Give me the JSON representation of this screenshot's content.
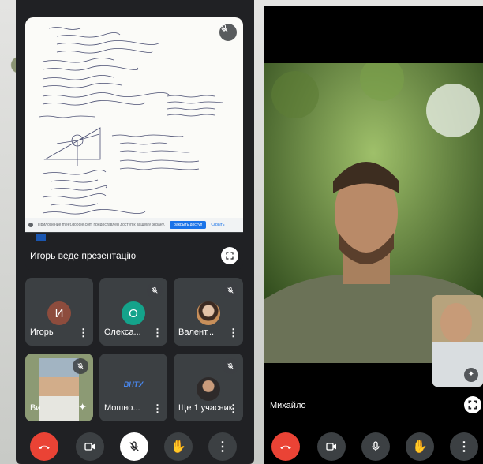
{
  "presentation": {
    "presenting_label": "Игорь веде презентацію",
    "share_notice": "Приложение meet.google.com предоставлен доступ к вашему экрану.",
    "share_button": "Закрыть доступ",
    "share_hide": "Скрыть"
  },
  "participants": [
    {
      "name": "Игорь",
      "initial": "И",
      "color": "#8d4c3d"
    },
    {
      "name": "Олекса...",
      "initial": "О",
      "color": "#14a38b"
    },
    {
      "name": "Валент...",
      "initial": "",
      "color": "#8a7d70"
    },
    {
      "name": "Ви",
      "initial": "",
      "color": "#8c9a74"
    },
    {
      "name": "Мошно...",
      "initial": "",
      "color": "#1f1f5c",
      "logo_text": "ВНТУ"
    },
    {
      "name": "Ще 1 учасник",
      "initial": "",
      "color": "#7b6f66"
    }
  ],
  "right": {
    "speaker_name": "Михайло"
  },
  "icons": [
    "mic-off-icon",
    "fullscreen-icon",
    "kebab-icon",
    "end-call-icon",
    "camera-icon",
    "mic-icon",
    "hand-icon",
    "more-icon",
    "sparkle-icon"
  ],
  "colors": {
    "end_call": "#ea4335",
    "tile": "#3c4043",
    "panel": "#202124",
    "accent": "#1a73e8"
  }
}
